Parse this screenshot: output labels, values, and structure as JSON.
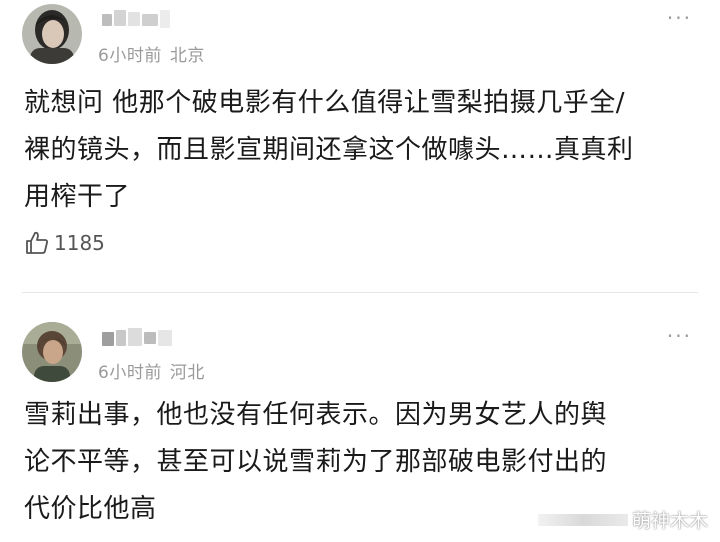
{
  "comments": [
    {
      "username": "",
      "time": "6小时前",
      "location": "北京",
      "text_lines": [
        "就想问 他那个破电影有什么值得让雪梨拍摄几乎全/",
        "裸的镜头，而且影宣期间还拿这个做噱头……真真利",
        "用榨干了"
      ],
      "likes": "1185",
      "more_icon": "···"
    },
    {
      "username": "",
      "time": "6小时前",
      "location": "河北",
      "text_lines": [
        "雪莉出事，他也没有任何表示。因为男女艺人的舆",
        "论不平等，甚至可以说雪莉为了那部破电影付出的",
        "代价比他高"
      ],
      "more_icon": "···"
    }
  ],
  "watermark": "萌神木木",
  "colors": {
    "text": "#1a1a1a",
    "meta": "#9a9a9a",
    "divider": "#e6e6e6"
  }
}
